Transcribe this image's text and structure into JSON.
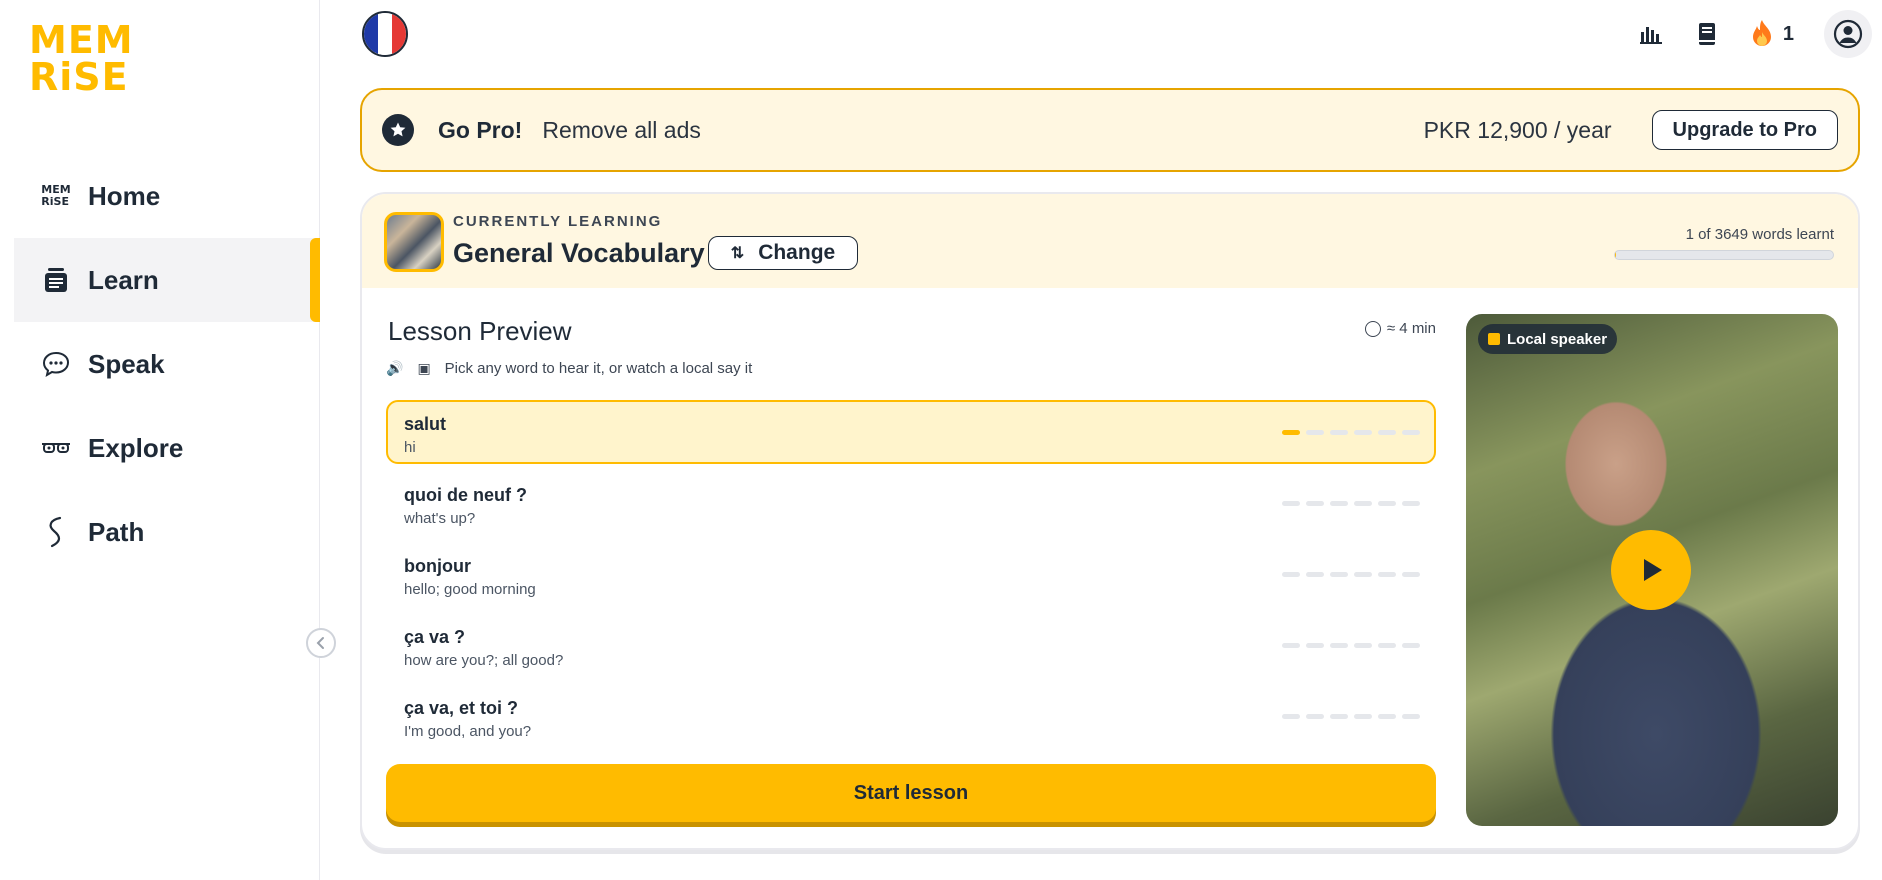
{
  "logo": {
    "line1": "MEM",
    "line2": "RiSE"
  },
  "sidebar": {
    "items": [
      {
        "label": "Home",
        "icon": "memrise-mini-logo-icon",
        "mini_logo_1": "MEM",
        "mini_logo_2": "RiSE"
      },
      {
        "label": "Learn",
        "icon": "cards-stack-icon",
        "active": true
      },
      {
        "label": "Speak",
        "icon": "speech-bubble-icon"
      },
      {
        "label": "Explore",
        "icon": "glasses-icon"
      },
      {
        "label": "Path",
        "icon": "path-squiggle-icon"
      }
    ]
  },
  "topbar": {
    "language_flag": "france-flag-icon",
    "streak_count": "1"
  },
  "promo": {
    "title": "Go Pro!",
    "subtitle": "Remove all ads",
    "price": "PKR 12,900 / year",
    "button": "Upgrade to Pro"
  },
  "course": {
    "label": "CURRENTLY LEARNING",
    "title": "General Vocabulary",
    "change_button": "Change",
    "progress_text": "1 of 3649 words learnt",
    "progress_fraction": 0.0003
  },
  "lesson": {
    "title": "Lesson Preview",
    "duration": "≈ 4 min",
    "hint": "Pick any word to hear it, or watch a local say it",
    "words": [
      {
        "fr": "salut",
        "en": "hi",
        "active": true,
        "level": 1
      },
      {
        "fr": "quoi de neuf ?",
        "en": "what's up?",
        "level": 0
      },
      {
        "fr": "bonjour",
        "en": "hello; good morning",
        "level": 0
      },
      {
        "fr": "ça va ?",
        "en": "how are you?; all good?",
        "level": 0
      },
      {
        "fr": "ça va, et toi ?",
        "en": "I'm good, and you?",
        "level": 0
      }
    ],
    "start_button": "Start lesson"
  },
  "video": {
    "tag": "Local speaker"
  },
  "colors": {
    "accent": "#ffbb00",
    "promo_bg": "#fff7e1",
    "text": "#1f2a37"
  }
}
